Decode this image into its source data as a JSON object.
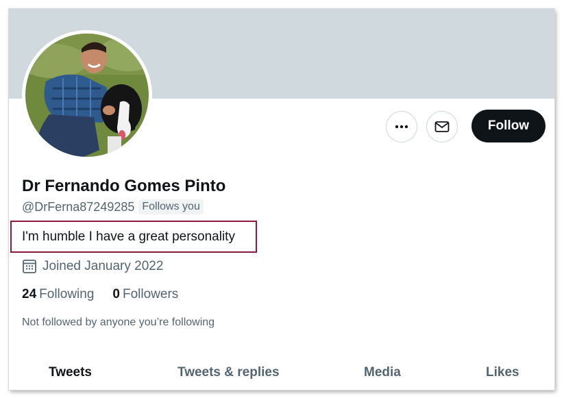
{
  "profile": {
    "display_name": "Dr Fernando Gomes Pinto",
    "handle": "@DrFerna87249285",
    "follows_you_badge": "Follows you",
    "bio": "I'm humble I have a great personality",
    "joined": "Joined January 2022",
    "following_count": "24",
    "following_label": "Following",
    "followers_count": "0",
    "followers_label": "Followers",
    "not_followed_note": "Not followed by anyone you’re following"
  },
  "actions": {
    "more_icon": "more-horizontal-icon",
    "message_icon": "envelope-icon",
    "follow_label": "Follow"
  },
  "tabs": [
    {
      "label": "Tweets",
      "active": true
    },
    {
      "label": "Tweets & replies",
      "active": false
    },
    {
      "label": "Media",
      "active": false
    },
    {
      "label": "Likes",
      "active": false
    }
  ],
  "colors": {
    "banner": "#cfd9de",
    "follow_button_bg": "#0f1419",
    "secondary_text": "#536471",
    "highlight_border": "#8b1a3a"
  }
}
